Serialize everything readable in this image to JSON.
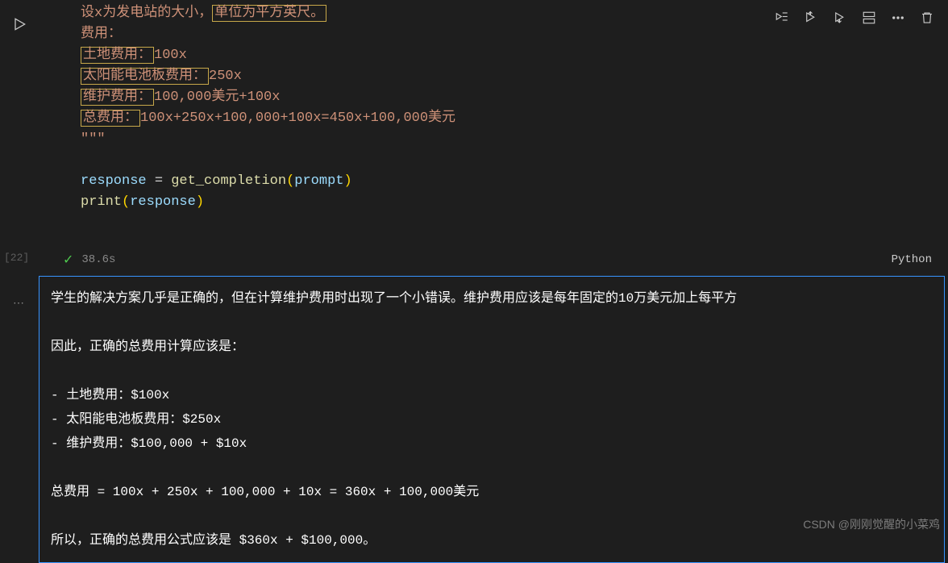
{
  "exec_count": "[22]",
  "code": {
    "l1_a": "设x为发电站的大小，",
    "l1_b": "单位为平方英尺。",
    "l2": "费用：",
    "l3_a": "土地费用：",
    "l3_b": "100x",
    "l4_a": "太阳能电池板费用：",
    "l4_b": "250x",
    "l5_a": "维护费用：",
    "l5_b": "100,000美元+100x",
    "l6_a": "总费用：",
    "l6_b": "100x+250x+100,000+100x=450x+100,000美元",
    "l7": "\"\"\"",
    "l9_a": "response",
    "l9_eq": " = ",
    "l9_fn": "get_completion",
    "l9_paren_o": "(",
    "l9_arg": "prompt",
    "l9_paren_c": ")",
    "l10_fn": "print",
    "l10_paren_o": "(",
    "l10_arg": "response",
    "l10_paren_c": ")"
  },
  "status": {
    "check": "✓",
    "time": "38.6s",
    "lang": "Python"
  },
  "output": {
    "l1": "学生的解决方案几乎是正确的，但在计算维护费用时出现了一个小错误。维护费用应该是每年固定的10万美元加上每平方",
    "l2": "因此，正确的总费用计算应该是：",
    "l3": "- 土地费用：$100x",
    "l4": "- 太阳能电池板费用：$250x",
    "l5": "- 维护费用：$100,000 + $10x",
    "l6": "总费用 = 100x + 250x + 100,000 + 10x = 360x + 100,000美元",
    "l7": "所以，正确的总费用公式应该是 $360x + $100,000。"
  },
  "watermark": "CSDN @刚刚觉醒的小菜鸡"
}
